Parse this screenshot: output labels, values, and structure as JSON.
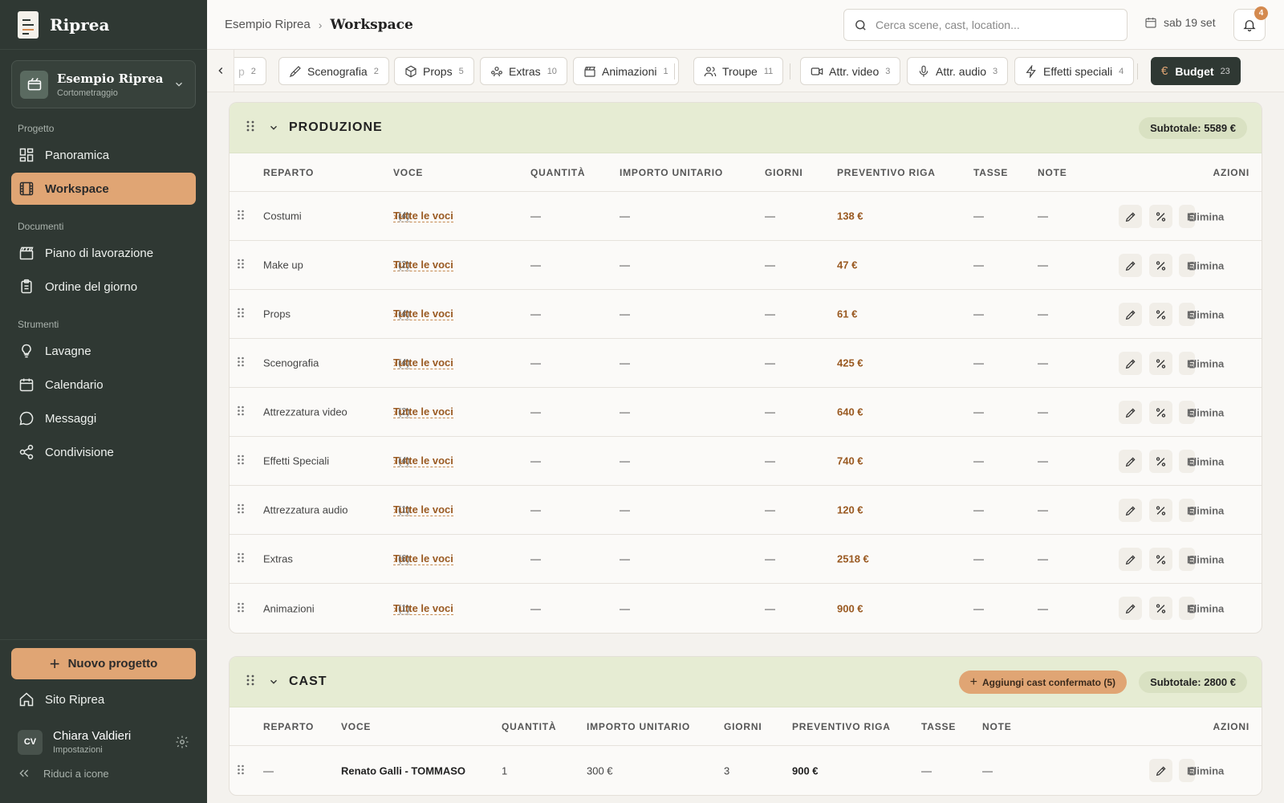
{
  "app": {
    "name": "Riprea"
  },
  "project": {
    "title": "Esempio Riprea",
    "subtitle": "Cortometraggio"
  },
  "nav": {
    "section_project": "Progetto",
    "overview": "Panoramica",
    "workspace": "Workspace",
    "section_documents": "Documenti",
    "schedule": "Piano di lavorazione",
    "call_sheet": "Ordine del giorno",
    "section_tools": "Strumenti",
    "boards": "Lavagne",
    "calendar": "Calendario",
    "messages": "Messaggi",
    "sharing": "Condivisione"
  },
  "sidebar_bottom": {
    "new_project": "Nuovo progetto",
    "site": "Sito Riprea",
    "user_initials": "CV",
    "user_name": "Chiara Valdieri",
    "user_sub": "Impostazioni",
    "collapse": "Riduci a icone"
  },
  "topbar": {
    "breadcrumb_root": "Esempio Riprea",
    "breadcrumb_current": "Workspace",
    "search_placeholder": "Cerca scene, cast, location...",
    "date": "sab 19 set",
    "notifications_count": "4"
  },
  "tabs": [
    {
      "label": "p",
      "count": "2"
    },
    {
      "label": "Scenografia",
      "count": "2"
    },
    {
      "label": "Props",
      "count": "5"
    },
    {
      "label": "Extras",
      "count": "10"
    },
    {
      "label": "Animazioni",
      "count": "1"
    },
    {
      "label": "Troupe",
      "count": "11"
    },
    {
      "label": "Attr. video",
      "count": "3"
    },
    {
      "label": "Attr. audio",
      "count": "3"
    },
    {
      "label": "Effetti speciali",
      "count": "4"
    },
    {
      "label": "Budget",
      "count": "23"
    }
  ],
  "produzione": {
    "title": "PRODUZIONE",
    "subtotal": "Subtotale: 5589 €",
    "headers": {
      "reparto": "REPARTO",
      "voce": "VOCE",
      "quantita": "QUANTITÀ",
      "importo": "IMPORTO UNITARIO",
      "giorni": "GIORNI",
      "preventivo": "PREVENTIVO RIGA",
      "tasse": "TASSE",
      "note": "NOTE",
      "azioni": "AZIONI"
    },
    "link_label": "Tutte le voci",
    "dash": "—",
    "delete_label": "Elimina",
    "rows": [
      {
        "reparto": "Costumi",
        "count": "(4)",
        "amount": "138 €"
      },
      {
        "reparto": "Make up",
        "count": "(2)",
        "amount": "47 €"
      },
      {
        "reparto": "Props",
        "count": "(4)",
        "amount": "61 €"
      },
      {
        "reparto": "Scenografia",
        "count": "(4)",
        "amount": "425 €"
      },
      {
        "reparto": "Attrezzatura video",
        "count": "(2)",
        "amount": "640 €"
      },
      {
        "reparto": "Effetti Speciali",
        "count": "(4)",
        "amount": "740 €"
      },
      {
        "reparto": "Attrezzatura audio",
        "count": "(1)",
        "amount": "120 €"
      },
      {
        "reparto": "Extras",
        "count": "(6)",
        "amount": "2518 €"
      },
      {
        "reparto": "Animazioni",
        "count": "(1)",
        "amount": "900 €"
      }
    ]
  },
  "cast": {
    "title": "CAST",
    "add_button": "Aggiungi cast confermato (5)",
    "subtotal": "Subtotale: 2800 €",
    "headers": {
      "reparto": "REPARTO",
      "voce": "VOCE",
      "quantita": "QUANTITÀ",
      "importo": "IMPORTO UNITARIO",
      "giorni": "GIORNI",
      "preventivo": "PREVENTIVO RIGA",
      "tasse": "TASSE",
      "note": "NOTE",
      "azioni": "AZIONI"
    },
    "delete_label": "Elimina",
    "rows": [
      {
        "reparto": "—",
        "voce": "Renato Galli - TOMMASO",
        "quantita": "1",
        "importo": "300 €",
        "giorni": "3",
        "preventivo": "900 €",
        "tasse": "—",
        "note": "—"
      }
    ]
  },
  "colors": {
    "sidebar": "#2f3833",
    "accent": "#e0a574",
    "section_header": "#e6ecd3",
    "amount": "#9a5a22"
  }
}
